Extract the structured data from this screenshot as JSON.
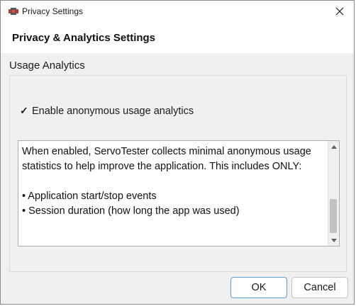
{
  "window": {
    "title": "Privacy Settings",
    "app_icon": "servo-app-icon",
    "close_icon": "close-icon"
  },
  "header": {
    "title": "Privacy & Analytics Settings"
  },
  "group": {
    "label": "Usage Analytics",
    "checkbox": {
      "label": "Enable anonymous usage analytics",
      "checked": true,
      "mark": "✓"
    },
    "description": {
      "text": "When enabled, ServoTester collects minimal anonymous usage statistics to help improve the application. This includes ONLY:\n\n• Application start/stop events\n• Session duration (how long the app was used)"
    }
  },
  "buttons": {
    "ok_label": "OK",
    "cancel_label": "Cancel"
  },
  "colors": {
    "window_bg": "#f0f0f0",
    "header_bg": "#ffffff",
    "ok_border": "#5aa0dd"
  }
}
